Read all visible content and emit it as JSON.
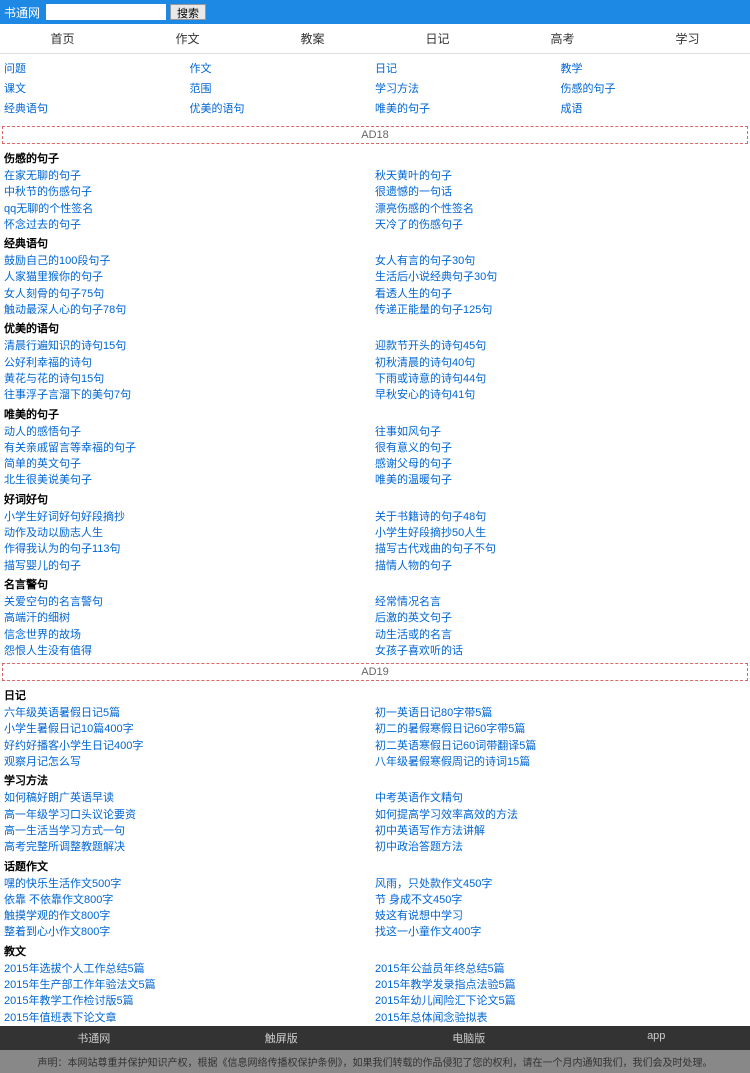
{
  "header": {
    "logo": "书通网",
    "search_placeholder": "",
    "search_btn": "搜索"
  },
  "nav": [
    "首页",
    "作文",
    "教案",
    "日记",
    "高考",
    "学习"
  ],
  "categories": [
    {
      "t": "问题"
    },
    {
      "t": "作文"
    },
    {
      "t": "日记"
    },
    {
      "t": "教学"
    },
    {
      "t": "课文"
    },
    {
      "t": "范围"
    },
    {
      "t": "学习方法"
    },
    {
      "t": "伤感的句子"
    },
    {
      "t": "经典语句"
    },
    {
      "t": "优美的语句"
    },
    {
      "t": "唯美的句子"
    },
    {
      "t": "成语"
    }
  ],
  "ad1": "AD18",
  "ad2": "AD19",
  "sections": [
    {
      "title": "伤感的句子",
      "items": [
        "在家无聊的句子",
        "秋天黄叶的句子",
        "中秋节的伤感句子",
        "很遗憾的一句话",
        "qq无聊的个性签名",
        "漂亮伤感的个性签名",
        "怀念过去的句子",
        "天冷了的伤感句子"
      ]
    },
    {
      "title": "经典语句",
      "items": [
        "鼓励自己的100段句子",
        "女人有言的句子30句",
        "人家猫里猴你的句子",
        "生活后小说经典句子30句",
        "女人刻骨的句子75句",
        "看透人生的句子",
        "触动最深人心的句子78句",
        "传递正能量的句子125句"
      ]
    },
    {
      "title": "优美的语句",
      "items": [
        "清晨行遍知识的诗句15句",
        "迎款节开头的诗句45句",
        "公好利幸福的诗句",
        "初秋清晨的诗句40句",
        "黄花与花的诗句15句",
        "下雨或诗意的诗句44句",
        "往事浮子言溜下的美句7句",
        "早秋安心的诗句41句"
      ]
    },
    {
      "title": "唯美的句子",
      "items": [
        "动人的感悟句子",
        "往事如风句子",
        "有关亲戚留言等幸福的句子",
        "很有意义的句子",
        "简单的英文句子",
        "感谢父母的句子",
        "北生很美说美句子",
        "唯美的温暖句子"
      ]
    },
    {
      "title": "好词好句",
      "items": [
        "小学生好词好句好段摘抄",
        "关于书籍诗的句子48句",
        "动作及动以励志人生",
        "小学生好段摘抄50人生",
        "作得我认为的句子113句",
        "描写古代戏曲的句子不句",
        "描写婴儿的句子",
        "描情人物的句子"
      ]
    },
    {
      "title": "名言警句",
      "items": [
        "关爱空句的名言警句",
        "经常情况名言",
        "高端汗的细树",
        "后激的英文句子",
        "信念世界的故场",
        "动生活或的名言",
        "怨恨人生没有值得",
        "女孩子喜欢听的话"
      ]
    }
  ],
  "sections2": [
    {
      "title": "日记",
      "items": [
        "六年级英语暑假日记5篇",
        "初一英语日记80字带5篇",
        "小学生暑假日记10篇400字",
        "初二的暑假寒假日记60字带5篇",
        "好约好播客小学生日记400字",
        "初二英语寒假日记60词带翻译5篇",
        "观察月记怎么写",
        "八年级暑假寒假周记的诗词15篇"
      ]
    },
    {
      "title": "学习方法",
      "items": [
        "如何稿好朗广英语早读",
        "中考英语作文精句",
        "高一年级学习口头议论要资",
        "如何提高学习效率高效的方法",
        "高一生活当学习方式一句",
        "初中英语写作方法讲解",
        "高考完整所调整教题解决",
        "初中政治答题方法"
      ]
    },
    {
      "title": "话题作文",
      "items": [
        "嘿的快乐生活作文500字",
        "风雨，只处款作文450字",
        "依靠 不依靠作文800字",
        "节 身成不文450字",
        "触摸学观的作文800字",
        "妓这有说想中学习",
        "整着到心小作文800字",
        "找这一小童作文400字"
      ]
    },
    {
      "title": "教文",
      "items": [
        "2015年选拔个人工作总结5篇",
        "2015年公益员年终总结5篇",
        "2015年生产部工作年验法文5篇",
        "2015年教学发录指点法验5篇",
        "2015年教学工作检讨版5篇",
        "2015年幼儿闻险汇下论文5篇",
        "2015年值班表下论文章",
        "2015年总体闻念验拟表"
      ]
    }
  ],
  "footer_nav": [
    "书通网",
    "触屏版",
    "电脑版",
    "app"
  ],
  "footer_text": "声明：本网站尊重并保护知识产权，根据《信息网络传播权保护条例》，如果我们转载的作品侵犯了您的权利，请在一个月内通知我们，我们会及时处理。"
}
